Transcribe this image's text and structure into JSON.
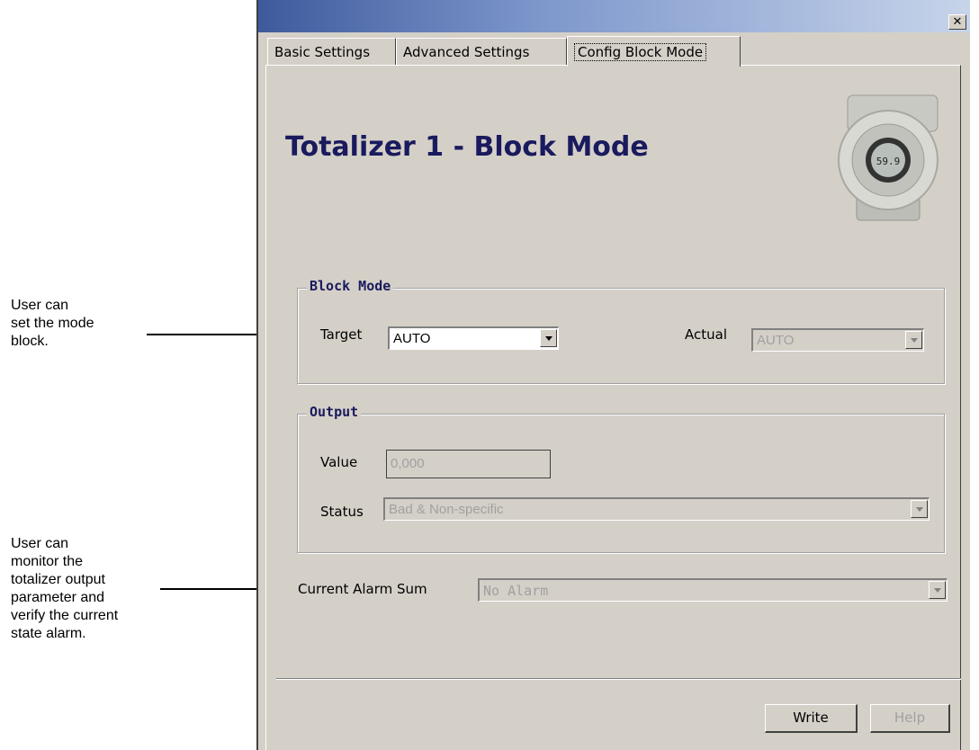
{
  "annotations": {
    "mode_note": [
      "User can",
      "set the mode",
      "block."
    ],
    "alarm_note": [
      "User can",
      "monitor the",
      "totalizer output",
      "parameter and",
      "verify the current",
      "state alarm."
    ]
  },
  "window": {
    "close_glyph": "✕"
  },
  "tabs": [
    {
      "label": "Basic Settings",
      "active": false
    },
    {
      "label": "Advanced Settings",
      "active": false
    },
    {
      "label": "Config Block Mode",
      "active": true
    }
  ],
  "page": {
    "title": "Totalizer 1 - Block Mode",
    "device_display": "59.9",
    "device_icon": "transmitter-device-icon"
  },
  "block_mode": {
    "group_label": "Block Mode",
    "target_label": "Target",
    "target_value": "AUTO",
    "actual_label": "Actual",
    "actual_value": "AUTO"
  },
  "output": {
    "group_label": "Output",
    "value_label": "Value",
    "value": "0,000",
    "status_label": "Status",
    "status_value": "Bad & Non-specific"
  },
  "alarm": {
    "label": "Current Alarm Sum",
    "value": "No Alarm"
  },
  "buttons": {
    "write": "Write",
    "help": "Help"
  }
}
